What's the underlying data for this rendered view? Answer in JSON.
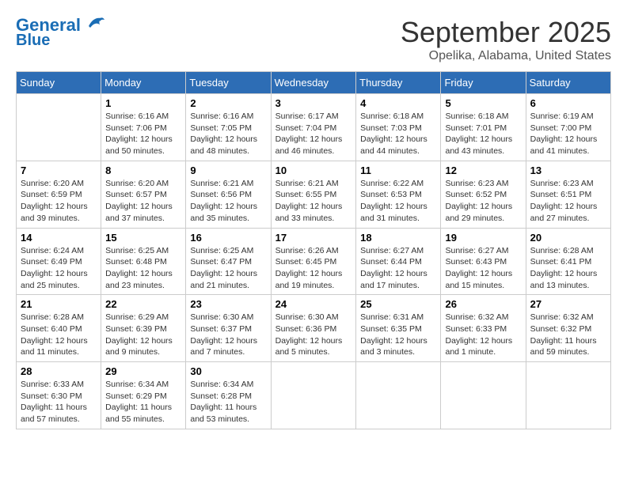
{
  "logo": {
    "line1": "General",
    "line2": "Blue"
  },
  "title": "September 2025",
  "subtitle": "Opelika, Alabama, United States",
  "days_header": [
    "Sunday",
    "Monday",
    "Tuesday",
    "Wednesday",
    "Thursday",
    "Friday",
    "Saturday"
  ],
  "weeks": [
    [
      {
        "day": "",
        "info": ""
      },
      {
        "day": "1",
        "info": "Sunrise: 6:16 AM\nSunset: 7:06 PM\nDaylight: 12 hours\nand 50 minutes."
      },
      {
        "day": "2",
        "info": "Sunrise: 6:16 AM\nSunset: 7:05 PM\nDaylight: 12 hours\nand 48 minutes."
      },
      {
        "day": "3",
        "info": "Sunrise: 6:17 AM\nSunset: 7:04 PM\nDaylight: 12 hours\nand 46 minutes."
      },
      {
        "day": "4",
        "info": "Sunrise: 6:18 AM\nSunset: 7:03 PM\nDaylight: 12 hours\nand 44 minutes."
      },
      {
        "day": "5",
        "info": "Sunrise: 6:18 AM\nSunset: 7:01 PM\nDaylight: 12 hours\nand 43 minutes."
      },
      {
        "day": "6",
        "info": "Sunrise: 6:19 AM\nSunset: 7:00 PM\nDaylight: 12 hours\nand 41 minutes."
      }
    ],
    [
      {
        "day": "7",
        "info": "Sunrise: 6:20 AM\nSunset: 6:59 PM\nDaylight: 12 hours\nand 39 minutes."
      },
      {
        "day": "8",
        "info": "Sunrise: 6:20 AM\nSunset: 6:57 PM\nDaylight: 12 hours\nand 37 minutes."
      },
      {
        "day": "9",
        "info": "Sunrise: 6:21 AM\nSunset: 6:56 PM\nDaylight: 12 hours\nand 35 minutes."
      },
      {
        "day": "10",
        "info": "Sunrise: 6:21 AM\nSunset: 6:55 PM\nDaylight: 12 hours\nand 33 minutes."
      },
      {
        "day": "11",
        "info": "Sunrise: 6:22 AM\nSunset: 6:53 PM\nDaylight: 12 hours\nand 31 minutes."
      },
      {
        "day": "12",
        "info": "Sunrise: 6:23 AM\nSunset: 6:52 PM\nDaylight: 12 hours\nand 29 minutes."
      },
      {
        "day": "13",
        "info": "Sunrise: 6:23 AM\nSunset: 6:51 PM\nDaylight: 12 hours\nand 27 minutes."
      }
    ],
    [
      {
        "day": "14",
        "info": "Sunrise: 6:24 AM\nSunset: 6:49 PM\nDaylight: 12 hours\nand 25 minutes."
      },
      {
        "day": "15",
        "info": "Sunrise: 6:25 AM\nSunset: 6:48 PM\nDaylight: 12 hours\nand 23 minutes."
      },
      {
        "day": "16",
        "info": "Sunrise: 6:25 AM\nSunset: 6:47 PM\nDaylight: 12 hours\nand 21 minutes."
      },
      {
        "day": "17",
        "info": "Sunrise: 6:26 AM\nSunset: 6:45 PM\nDaylight: 12 hours\nand 19 minutes."
      },
      {
        "day": "18",
        "info": "Sunrise: 6:27 AM\nSunset: 6:44 PM\nDaylight: 12 hours\nand 17 minutes."
      },
      {
        "day": "19",
        "info": "Sunrise: 6:27 AM\nSunset: 6:43 PM\nDaylight: 12 hours\nand 15 minutes."
      },
      {
        "day": "20",
        "info": "Sunrise: 6:28 AM\nSunset: 6:41 PM\nDaylight: 12 hours\nand 13 minutes."
      }
    ],
    [
      {
        "day": "21",
        "info": "Sunrise: 6:28 AM\nSunset: 6:40 PM\nDaylight: 12 hours\nand 11 minutes."
      },
      {
        "day": "22",
        "info": "Sunrise: 6:29 AM\nSunset: 6:39 PM\nDaylight: 12 hours\nand 9 minutes."
      },
      {
        "day": "23",
        "info": "Sunrise: 6:30 AM\nSunset: 6:37 PM\nDaylight: 12 hours\nand 7 minutes."
      },
      {
        "day": "24",
        "info": "Sunrise: 6:30 AM\nSunset: 6:36 PM\nDaylight: 12 hours\nand 5 minutes."
      },
      {
        "day": "25",
        "info": "Sunrise: 6:31 AM\nSunset: 6:35 PM\nDaylight: 12 hours\nand 3 minutes."
      },
      {
        "day": "26",
        "info": "Sunrise: 6:32 AM\nSunset: 6:33 PM\nDaylight: 12 hours\nand 1 minute."
      },
      {
        "day": "27",
        "info": "Sunrise: 6:32 AM\nSunset: 6:32 PM\nDaylight: 11 hours\nand 59 minutes."
      }
    ],
    [
      {
        "day": "28",
        "info": "Sunrise: 6:33 AM\nSunset: 6:30 PM\nDaylight: 11 hours\nand 57 minutes."
      },
      {
        "day": "29",
        "info": "Sunrise: 6:34 AM\nSunset: 6:29 PM\nDaylight: 11 hours\nand 55 minutes."
      },
      {
        "day": "30",
        "info": "Sunrise: 6:34 AM\nSunset: 6:28 PM\nDaylight: 11 hours\nand 53 minutes."
      },
      {
        "day": "",
        "info": ""
      },
      {
        "day": "",
        "info": ""
      },
      {
        "day": "",
        "info": ""
      },
      {
        "day": "",
        "info": ""
      }
    ]
  ]
}
